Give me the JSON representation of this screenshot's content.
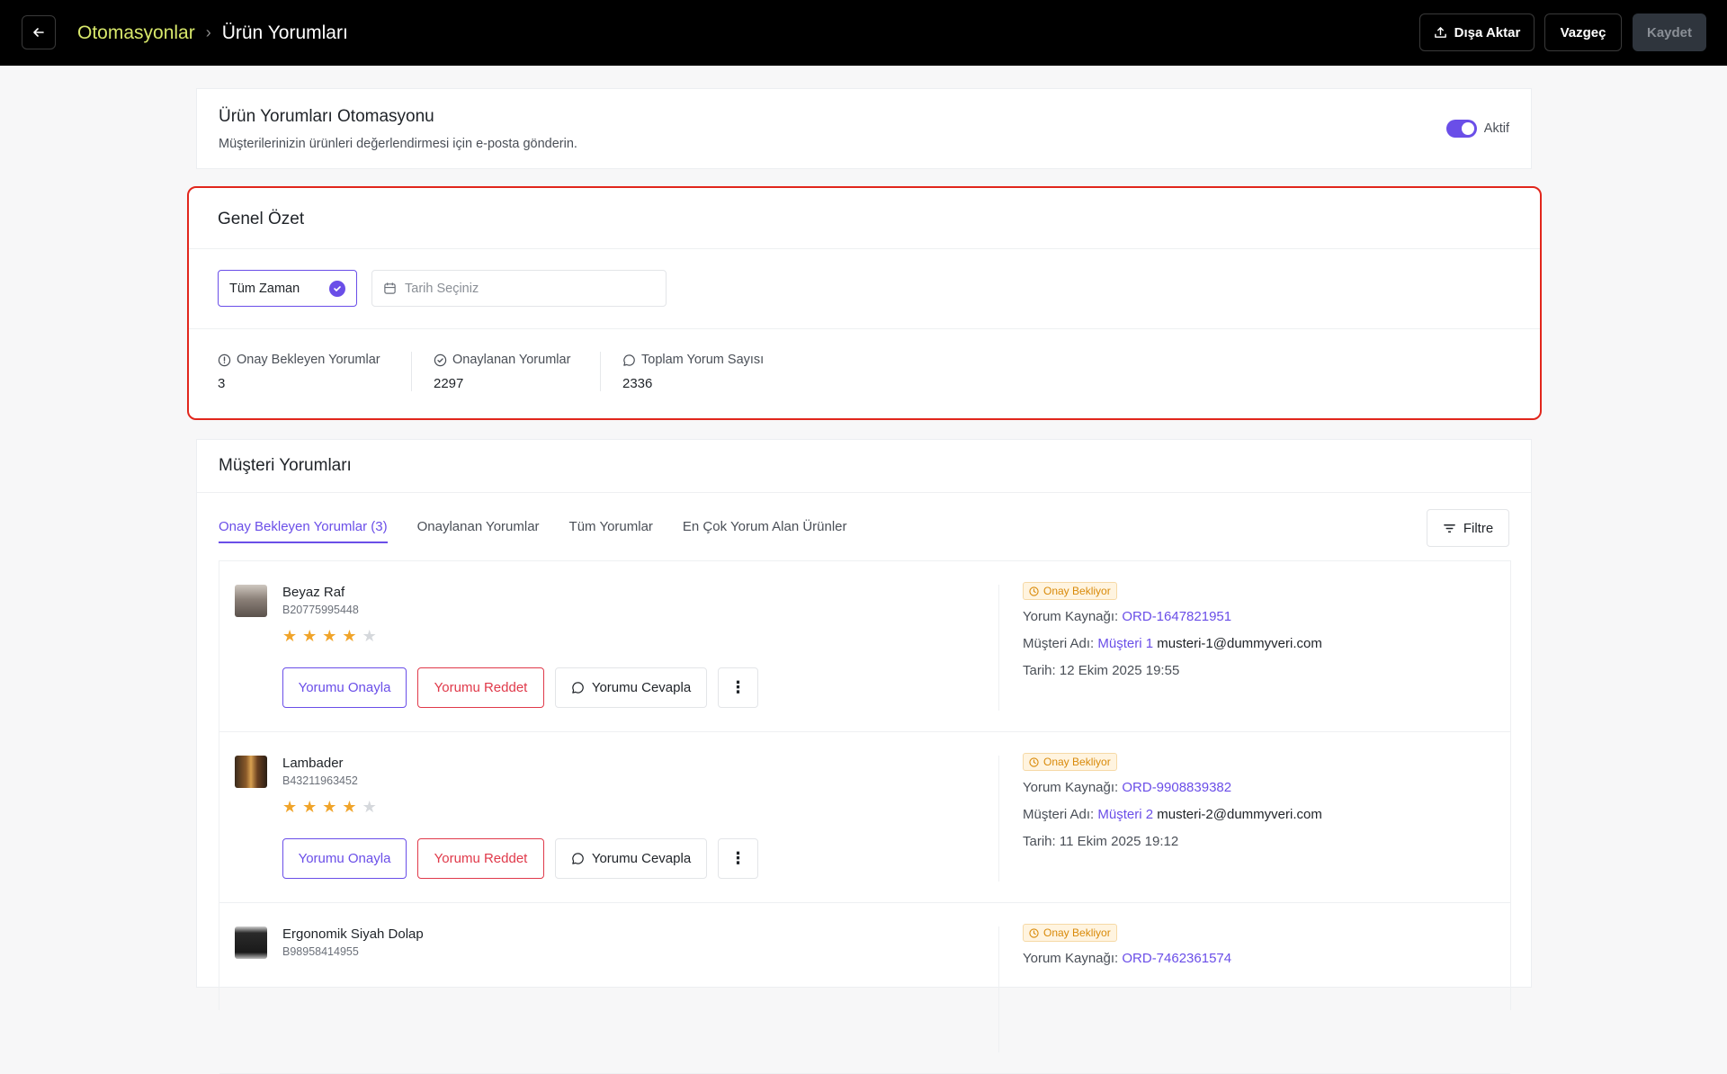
{
  "header": {
    "breadcrumb_parent": "Otomasyonlar",
    "breadcrumb_separator": "›",
    "breadcrumb_current": "Ürün Yorumları",
    "export_label": "Dışa Aktar",
    "cancel_label": "Vazgeç",
    "save_label": "Kaydet"
  },
  "automation": {
    "title": "Ürün Yorumları Otomasyonu",
    "description": "Müşterilerinizin ürünleri değerlendirmesi için e-posta gönderin.",
    "status_label": "Aktif",
    "enabled": true
  },
  "summary": {
    "title": "Genel Özet",
    "period_selected": "Tüm Zaman",
    "date_placeholder": "Tarih Seçiniz",
    "stats": [
      {
        "label": "Onay Bekleyen Yorumlar",
        "value": "3",
        "icon": "alert-circle-icon"
      },
      {
        "label": "Onaylanan Yorumlar",
        "value": "2297",
        "icon": "check-circle-icon"
      },
      {
        "label": "Toplam Yorum Sayısı",
        "value": "2336",
        "icon": "chat-icon"
      }
    ]
  },
  "reviews": {
    "title": "Müşteri Yorumları",
    "tabs": [
      "Onay Bekleyen Yorumlar (3)",
      "Onaylanan Yorumlar",
      "Tüm Yorumlar",
      "En Çok Yorum Alan Ürünler"
    ],
    "active_tab": 0,
    "filter_label": "Filtre",
    "actions": {
      "approve": "Yorumu Onayla",
      "reject": "Yorumu Reddet",
      "reply": "Yorumu Cevapla",
      "more": "⋮"
    },
    "labels": {
      "source": "Yorum Kaynağı:",
      "customer": "Müşteri Adı:",
      "date": "Tarih:"
    },
    "items": [
      {
        "product": "Beyaz Raf",
        "code": "B20775995448",
        "rating": 4,
        "status": "Onay Bekliyor",
        "source": "ORD-1647821951",
        "customer_name": "Müşteri 1",
        "customer_email": "musteri-1@dummyveri.com",
        "date": "12 Ekim 2025 19:55"
      },
      {
        "product": "Lambader",
        "code": "B43211963452",
        "rating": 4,
        "status": "Onay Bekliyor",
        "source": "ORD-9908839382",
        "customer_name": "Müşteri 2",
        "customer_email": "musteri-2@dummyveri.com",
        "date": "11 Ekim 2025 19:12"
      },
      {
        "product": "Ergonomik Siyah Dolap",
        "code": "B98958414955",
        "rating": 0,
        "status": "Onay Bekliyor",
        "source": "ORD-7462361574",
        "customer_name": "",
        "customer_email": "",
        "date": ""
      }
    ]
  },
  "colors": {
    "accent": "#6a4ee8",
    "danger": "#e0394a",
    "highlight_border": "#e1261c",
    "breadcrumb_accent": "#d8e86b",
    "warning": "#d98a0a",
    "star": "#f0a42a"
  }
}
